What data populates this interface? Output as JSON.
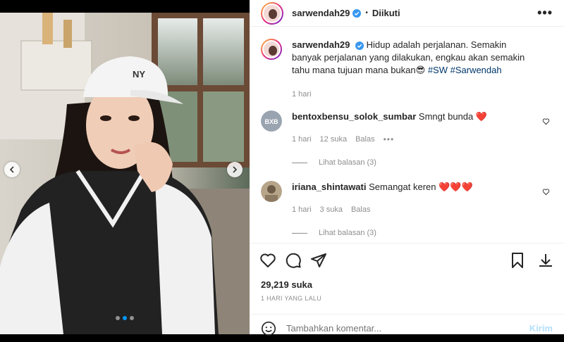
{
  "post": {
    "username": "sarwendah29",
    "follow_status": "Diikuti",
    "caption": "Hidup adalah perjalanan. Semakin banyak perjalanan yang dilakukan, engkau akan semakin tahu mana tujuan mana bukan😎",
    "hashtags": "#SW #Sarwendah",
    "caption_time": "1 hari",
    "likes": "29,219 suka",
    "timestamp": "1 HARI YANG LALU",
    "carousel_index": 2,
    "carousel_total": 3
  },
  "comments": [
    {
      "username": "bentoxbensu_solok_sumbar",
      "text": "Smngt bunda",
      "hearts": "❤️",
      "time": "1 hari",
      "likes": "12 suka",
      "reply": "Balas",
      "more": "•••",
      "view_replies": "Lihat balasan (3)"
    },
    {
      "username": "iriana_shintawati",
      "text": "Semangat keren",
      "hearts": "❤️❤️❤️",
      "time": "1 hari",
      "likes": "3 suka",
      "reply": "Balas",
      "view_replies": "Lihat balasan (3)"
    }
  ],
  "comment_box": {
    "placeholder": "Tambahkan komentar...",
    "post_label": "Kirim"
  },
  "header": {
    "separator": "•",
    "more": "•••"
  },
  "icons": {
    "prev": "chevron-left-icon",
    "next": "chevron-right-icon",
    "like": "heart-icon",
    "comment": "comment-icon",
    "share": "paper-plane-icon",
    "save": "bookmark-icon",
    "download": "download-icon",
    "emoji": "smiley-icon"
  },
  "colors": {
    "accent": "#0095f6",
    "hashtag": "#00376b",
    "heart": "#ed4956",
    "post_disabled": "#b2dffc"
  }
}
